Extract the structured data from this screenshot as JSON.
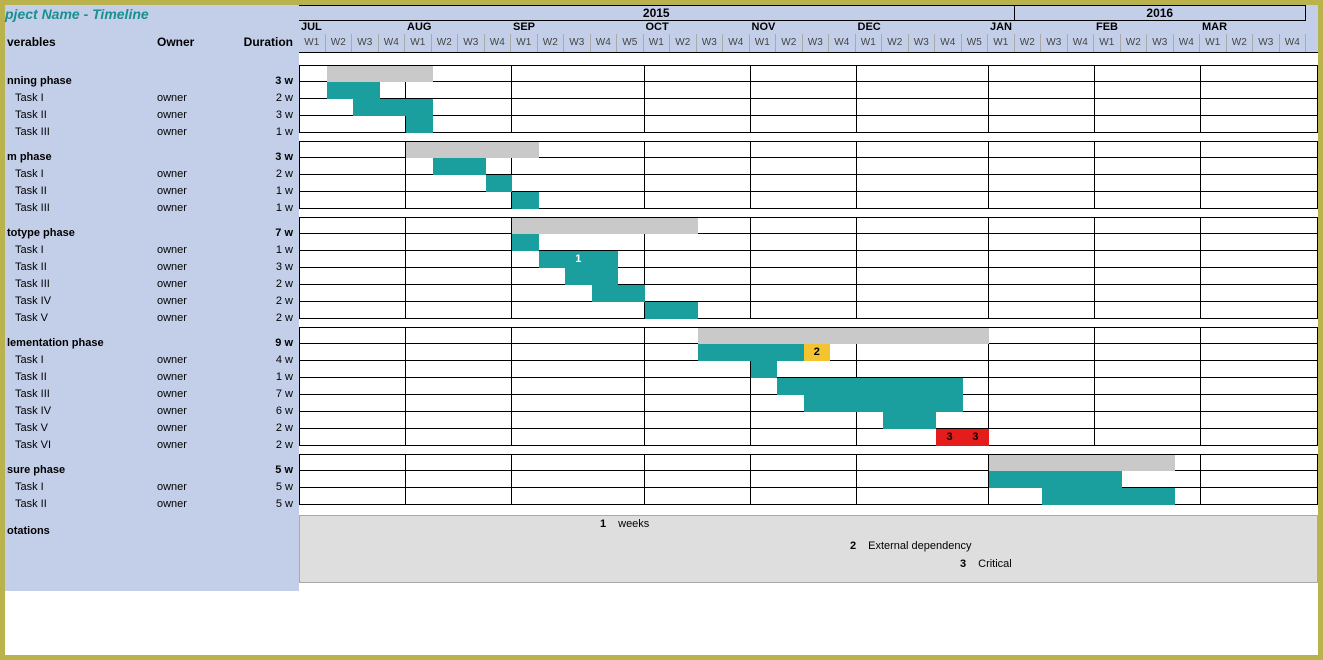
{
  "title": "pject Name - Timeline",
  "headers": {
    "deliverables": "verables",
    "owner": "Owner",
    "duration": "Duration"
  },
  "years": [
    {
      "label": "2015",
      "span": 27
    },
    {
      "label": "2016",
      "span": 11
    }
  ],
  "months": [
    {
      "label": "JUL",
      "weeks": [
        "W1",
        "W2",
        "W3",
        "W4"
      ]
    },
    {
      "label": "AUG",
      "weeks": [
        "W1",
        "W2",
        "W3",
        "W4"
      ]
    },
    {
      "label": "SEP",
      "weeks": [
        "W1",
        "W2",
        "W3",
        "W4",
        "W5"
      ]
    },
    {
      "label": "OCT",
      "weeks": [
        "W1",
        "W2",
        "W3",
        "W4"
      ]
    },
    {
      "label": "NOV",
      "weeks": [
        "W1",
        "W2",
        "W3",
        "W4"
      ]
    },
    {
      "label": "DEC",
      "weeks": [
        "W1",
        "W2",
        "W3",
        "W4",
        "W5"
      ]
    },
    {
      "label": "JAN",
      "weeks": [
        "W1",
        "W2",
        "W3",
        "W4"
      ]
    },
    {
      "label": "FEB",
      "weeks": [
        "W1",
        "W2",
        "W3",
        "W4"
      ]
    },
    {
      "label": "MAR",
      "weeks": [
        "W1",
        "W2",
        "W3",
        "W4"
      ]
    }
  ],
  "monthStarts": [
    0,
    4,
    8,
    13,
    17,
    21,
    26,
    30,
    34
  ],
  "phases": [
    {
      "name": "nning phase",
      "duration": "3 w",
      "summary": {
        "start": 1,
        "end": 5
      },
      "tasks": [
        {
          "name": "Task I",
          "owner": "owner",
          "duration": "2 w",
          "start": 1,
          "end": 3
        },
        {
          "name": "Task II",
          "owner": "owner",
          "duration": "3 w",
          "start": 2,
          "end": 5
        },
        {
          "name": "Task III",
          "owner": "owner",
          "duration": "1 w",
          "start": 4,
          "end": 5
        }
      ]
    },
    {
      "name": "m phase",
      "duration": "3 w",
      "summary": {
        "start": 4,
        "end": 9
      },
      "tasks": [
        {
          "name": "Task I",
          "owner": "owner",
          "duration": "2 w",
          "start": 5,
          "end": 7
        },
        {
          "name": "Task II",
          "owner": "owner",
          "duration": "1 w",
          "start": 7,
          "end": 8
        },
        {
          "name": "Task III",
          "owner": "owner",
          "duration": "1 w",
          "start": 8,
          "end": 9
        }
      ]
    },
    {
      "name": "totype phase",
      "duration": "7 w",
      "summary": {
        "start": 8,
        "end": 15
      },
      "tasks": [
        {
          "name": "Task I",
          "owner": "owner",
          "duration": "1 w",
          "start": 8,
          "end": 9
        },
        {
          "name": "Task II",
          "owner": "owner",
          "duration": "3 w",
          "start": 9,
          "end": 12,
          "label": "1"
        },
        {
          "name": "Task III",
          "owner": "owner",
          "duration": "2 w",
          "start": 10,
          "end": 12
        },
        {
          "name": "Task IV",
          "owner": "owner",
          "duration": "2 w",
          "start": 11,
          "end": 13
        },
        {
          "name": "Task V",
          "owner": "owner",
          "duration": "2 w",
          "start": 13,
          "end": 15
        }
      ]
    },
    {
      "name": "lementation phase",
      "duration": "9 w",
      "summary": {
        "start": 15,
        "end": 26
      },
      "tasks": [
        {
          "name": "Task I",
          "owner": "owner",
          "duration": "4 w",
          "start": 15,
          "end": 19,
          "marker": {
            "type": "gold",
            "at": 19,
            "span": 1,
            "text": "2"
          }
        },
        {
          "name": "Task II",
          "owner": "owner",
          "duration": "1 w",
          "start": 17,
          "end": 18
        },
        {
          "name": "Task III",
          "owner": "owner",
          "duration": "7 w",
          "start": 18,
          "end": 25
        },
        {
          "name": "Task IV",
          "owner": "owner",
          "duration": "6 w",
          "start": 19,
          "end": 25
        },
        {
          "name": "Task V",
          "owner": "owner",
          "duration": "2 w",
          "start": 22,
          "end": 24
        },
        {
          "name": "Task VI",
          "owner": "owner",
          "duration": "2 w",
          "start": 24,
          "end": 26,
          "style": "red",
          "text": "3   3"
        }
      ]
    },
    {
      "name": "sure phase",
      "duration": "5 w",
      "summary": {
        "start": 26,
        "end": 33
      },
      "tasks": [
        {
          "name": "Task I",
          "owner": "owner",
          "duration": "5 w",
          "start": 26,
          "end": 31
        },
        {
          "name": "Task II",
          "owner": "owner",
          "duration": "5 w",
          "start": 28,
          "end": 33
        }
      ]
    }
  ],
  "annotations_header": "otations",
  "annotations": [
    {
      "num": "1",
      "text": "weeks"
    },
    {
      "num": "2",
      "text": "External dependency"
    },
    {
      "num": "3",
      "text": "Critical"
    }
  ],
  "chart_data": {
    "type": "gantt",
    "unit": "weeks",
    "start": "2015-07 W1",
    "columns": 38,
    "title": "Project Name - Timeline",
    "series": [
      {
        "phase": "Planning phase",
        "duration_w": 3,
        "summary": [
          1,
          5
        ],
        "tasks": [
          {
            "name": "Task I",
            "owner": "owner",
            "start_w": 1,
            "end_w": 3
          },
          {
            "name": "Task II",
            "owner": "owner",
            "start_w": 2,
            "end_w": 5
          },
          {
            "name": "Task III",
            "owner": "owner",
            "start_w": 4,
            "end_w": 5
          }
        ]
      },
      {
        "phase": "M phase",
        "duration_w": 3,
        "summary": [
          4,
          9
        ],
        "tasks": [
          {
            "name": "Task I",
            "owner": "owner",
            "start_w": 5,
            "end_w": 7
          },
          {
            "name": "Task II",
            "owner": "owner",
            "start_w": 7,
            "end_w": 8
          },
          {
            "name": "Task III",
            "owner": "owner",
            "start_w": 8,
            "end_w": 9
          }
        ]
      },
      {
        "phase": "Prototype phase",
        "duration_w": 7,
        "summary": [
          8,
          15
        ],
        "tasks": [
          {
            "name": "Task I",
            "owner": "owner",
            "start_w": 8,
            "end_w": 9
          },
          {
            "name": "Task II",
            "owner": "owner",
            "start_w": 9,
            "end_w": 12,
            "note": "1"
          },
          {
            "name": "Task III",
            "owner": "owner",
            "start_w": 10,
            "end_w": 12
          },
          {
            "name": "Task IV",
            "owner": "owner",
            "start_w": 11,
            "end_w": 13
          },
          {
            "name": "Task V",
            "owner": "owner",
            "start_w": 13,
            "end_w": 15
          }
        ]
      },
      {
        "phase": "Implementation phase",
        "duration_w": 9,
        "summary": [
          15,
          26
        ],
        "tasks": [
          {
            "name": "Task I",
            "owner": "owner",
            "start_w": 15,
            "end_w": 19,
            "marker": {
              "type": "external_dependency",
              "note": "2",
              "at_w": 19
            }
          },
          {
            "name": "Task II",
            "owner": "owner",
            "start_w": 17,
            "end_w": 18
          },
          {
            "name": "Task III",
            "owner": "owner",
            "start_w": 18,
            "end_w": 25
          },
          {
            "name": "Task IV",
            "owner": "owner",
            "start_w": 19,
            "end_w": 25
          },
          {
            "name": "Task V",
            "owner": "owner",
            "start_w": 22,
            "end_w": 24
          },
          {
            "name": "Task VI",
            "owner": "owner",
            "start_w": 24,
            "end_w": 26,
            "status": "critical",
            "note": "3"
          }
        ]
      },
      {
        "phase": "Closure phase",
        "duration_w": 5,
        "summary": [
          26,
          33
        ],
        "tasks": [
          {
            "name": "Task I",
            "owner": "owner",
            "start_w": 26,
            "end_w": 31
          },
          {
            "name": "Task II",
            "owner": "owner",
            "start_w": 28,
            "end_w": 33
          }
        ]
      }
    ],
    "legend": [
      {
        "id": "1",
        "label": "weeks"
      },
      {
        "id": "2",
        "label": "External dependency"
      },
      {
        "id": "3",
        "label": "Critical"
      }
    ]
  }
}
